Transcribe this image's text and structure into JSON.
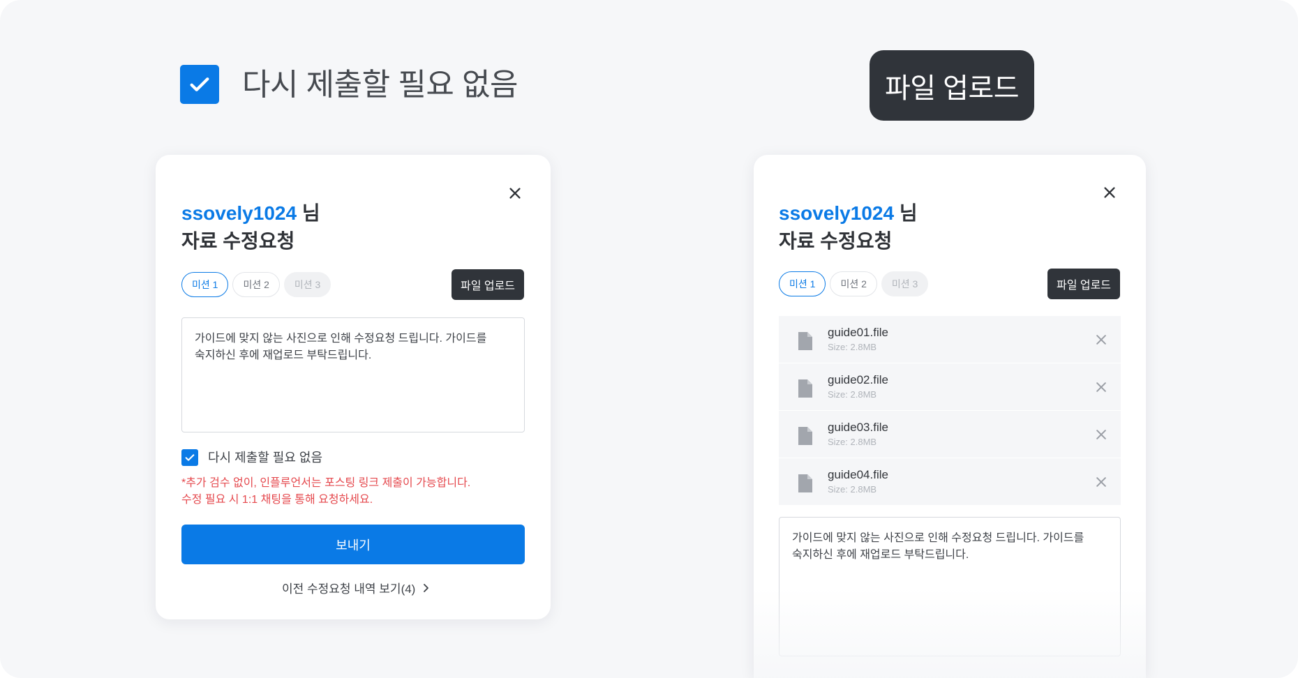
{
  "showcase": {
    "checkbox_label": "다시 제출할 필요 없음",
    "upload_button": "파일 업로드"
  },
  "left_card": {
    "username": "ssovely1024",
    "honorific": "님",
    "subtitle": "자료 수정요청",
    "tabs": [
      {
        "label": "미션 1",
        "state": "active"
      },
      {
        "label": "미션 2",
        "state": "default"
      },
      {
        "label": "미션 3",
        "state": "disabled"
      }
    ],
    "upload_button": "파일 업로드",
    "message_line1": "가이드에 맞지 않는 사진으로 인해 수정요청 드립니다. 가이드를",
    "message_line2": "숙지하신 후에 재업로드 부탁드립니다.",
    "checkbox_label": "다시 제출할 필요 없음",
    "checkbox_checked": true,
    "notice_line1": "*추가 검수 없이, 인플루언서는 포스팅 링크 제출이 가능합니다.",
    "notice_line2": "수정 필요 시 1:1 채팅을 통해 요청하세요.",
    "send_button": "보내기",
    "history_link": "이전 수정요청 내역 보기(4)"
  },
  "right_card": {
    "username": "ssovely1024",
    "honorific": "님",
    "subtitle": "자료 수정요청",
    "tabs": [
      {
        "label": "미션 1",
        "state": "active"
      },
      {
        "label": "미션 2",
        "state": "default"
      },
      {
        "label": "미션 3",
        "state": "disabled"
      }
    ],
    "upload_button": "파일 업로드",
    "files": [
      {
        "name": "guide01.file",
        "size": "Size: 2.8MB"
      },
      {
        "name": "guide02.file",
        "size": "Size: 2.8MB"
      },
      {
        "name": "guide03.file",
        "size": "Size: 2.8MB"
      },
      {
        "name": "guide04.file",
        "size": "Size: 2.8MB"
      }
    ],
    "message_line1": "가이드에 맞지 않는 사진으로 인해 수정요청 드립니다. 가이드를",
    "message_line2": "숙지하신 후에 재업로드 부탁드립니다."
  },
  "colors": {
    "accent": "#0a7ae6",
    "dark_button": "#30343a",
    "notice": "#e5484d",
    "background": "#f6f7f9"
  },
  "icons": {
    "checkbox": "check-icon",
    "close": "close-icon",
    "file": "file-icon",
    "remove": "remove-icon",
    "chevron": "chevron-right-icon"
  }
}
